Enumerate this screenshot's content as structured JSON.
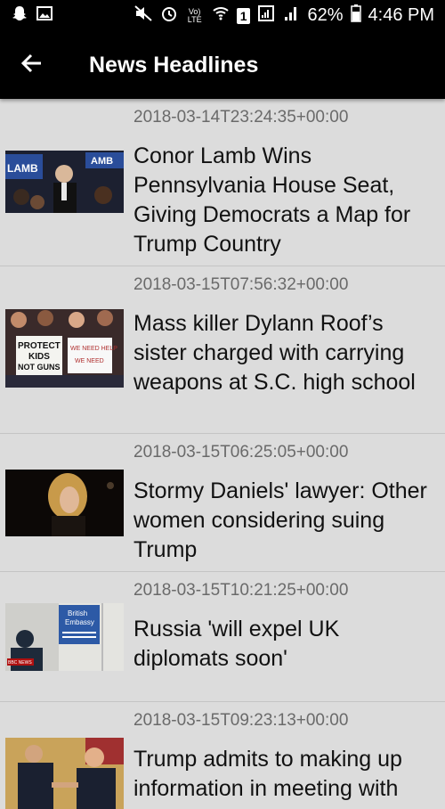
{
  "status_bar": {
    "battery_percent": "62%",
    "time": "4:46 PM",
    "sim_number": "1",
    "volte_label": "Vo) LTE"
  },
  "app_bar": {
    "title": "News Headlines",
    "back_icon": "arrow-left-icon"
  },
  "articles": [
    {
      "date": "2018-03-14T23:24:35+00:00",
      "headline": "Conor Lamb Wins Pennsylvania House Seat, Giving Democrats a Map for Trump Country",
      "thumbnail_text": [
        "LAMB",
        "AMB"
      ]
    },
    {
      "date": "2018-03-15T07:56:32+00:00",
      "headline": "Mass killer Dylann Roof’s sister charged with carrying weapons at S.C. high school",
      "thumbnail_text": [
        "PROTECT",
        "KIDS",
        "NOT GUNS",
        "WE NEED HELP",
        "WE NEED"
      ]
    },
    {
      "date": "2018-03-15T06:25:05+00:00",
      "headline": "Stormy Daniels' lawyer: Other women considering suing Trump",
      "thumbnail_text": []
    },
    {
      "date": "2018-03-15T10:21:25+00:00",
      "headline": "Russia 'will expel UK diplomats soon'",
      "thumbnail_text": [
        "British",
        "Embassy",
        "BBC NEWS"
      ]
    },
    {
      "date": "2018-03-15T09:23:13+00:00",
      "headline": "Trump admits to making up information in meeting with",
      "thumbnail_text": []
    }
  ]
}
